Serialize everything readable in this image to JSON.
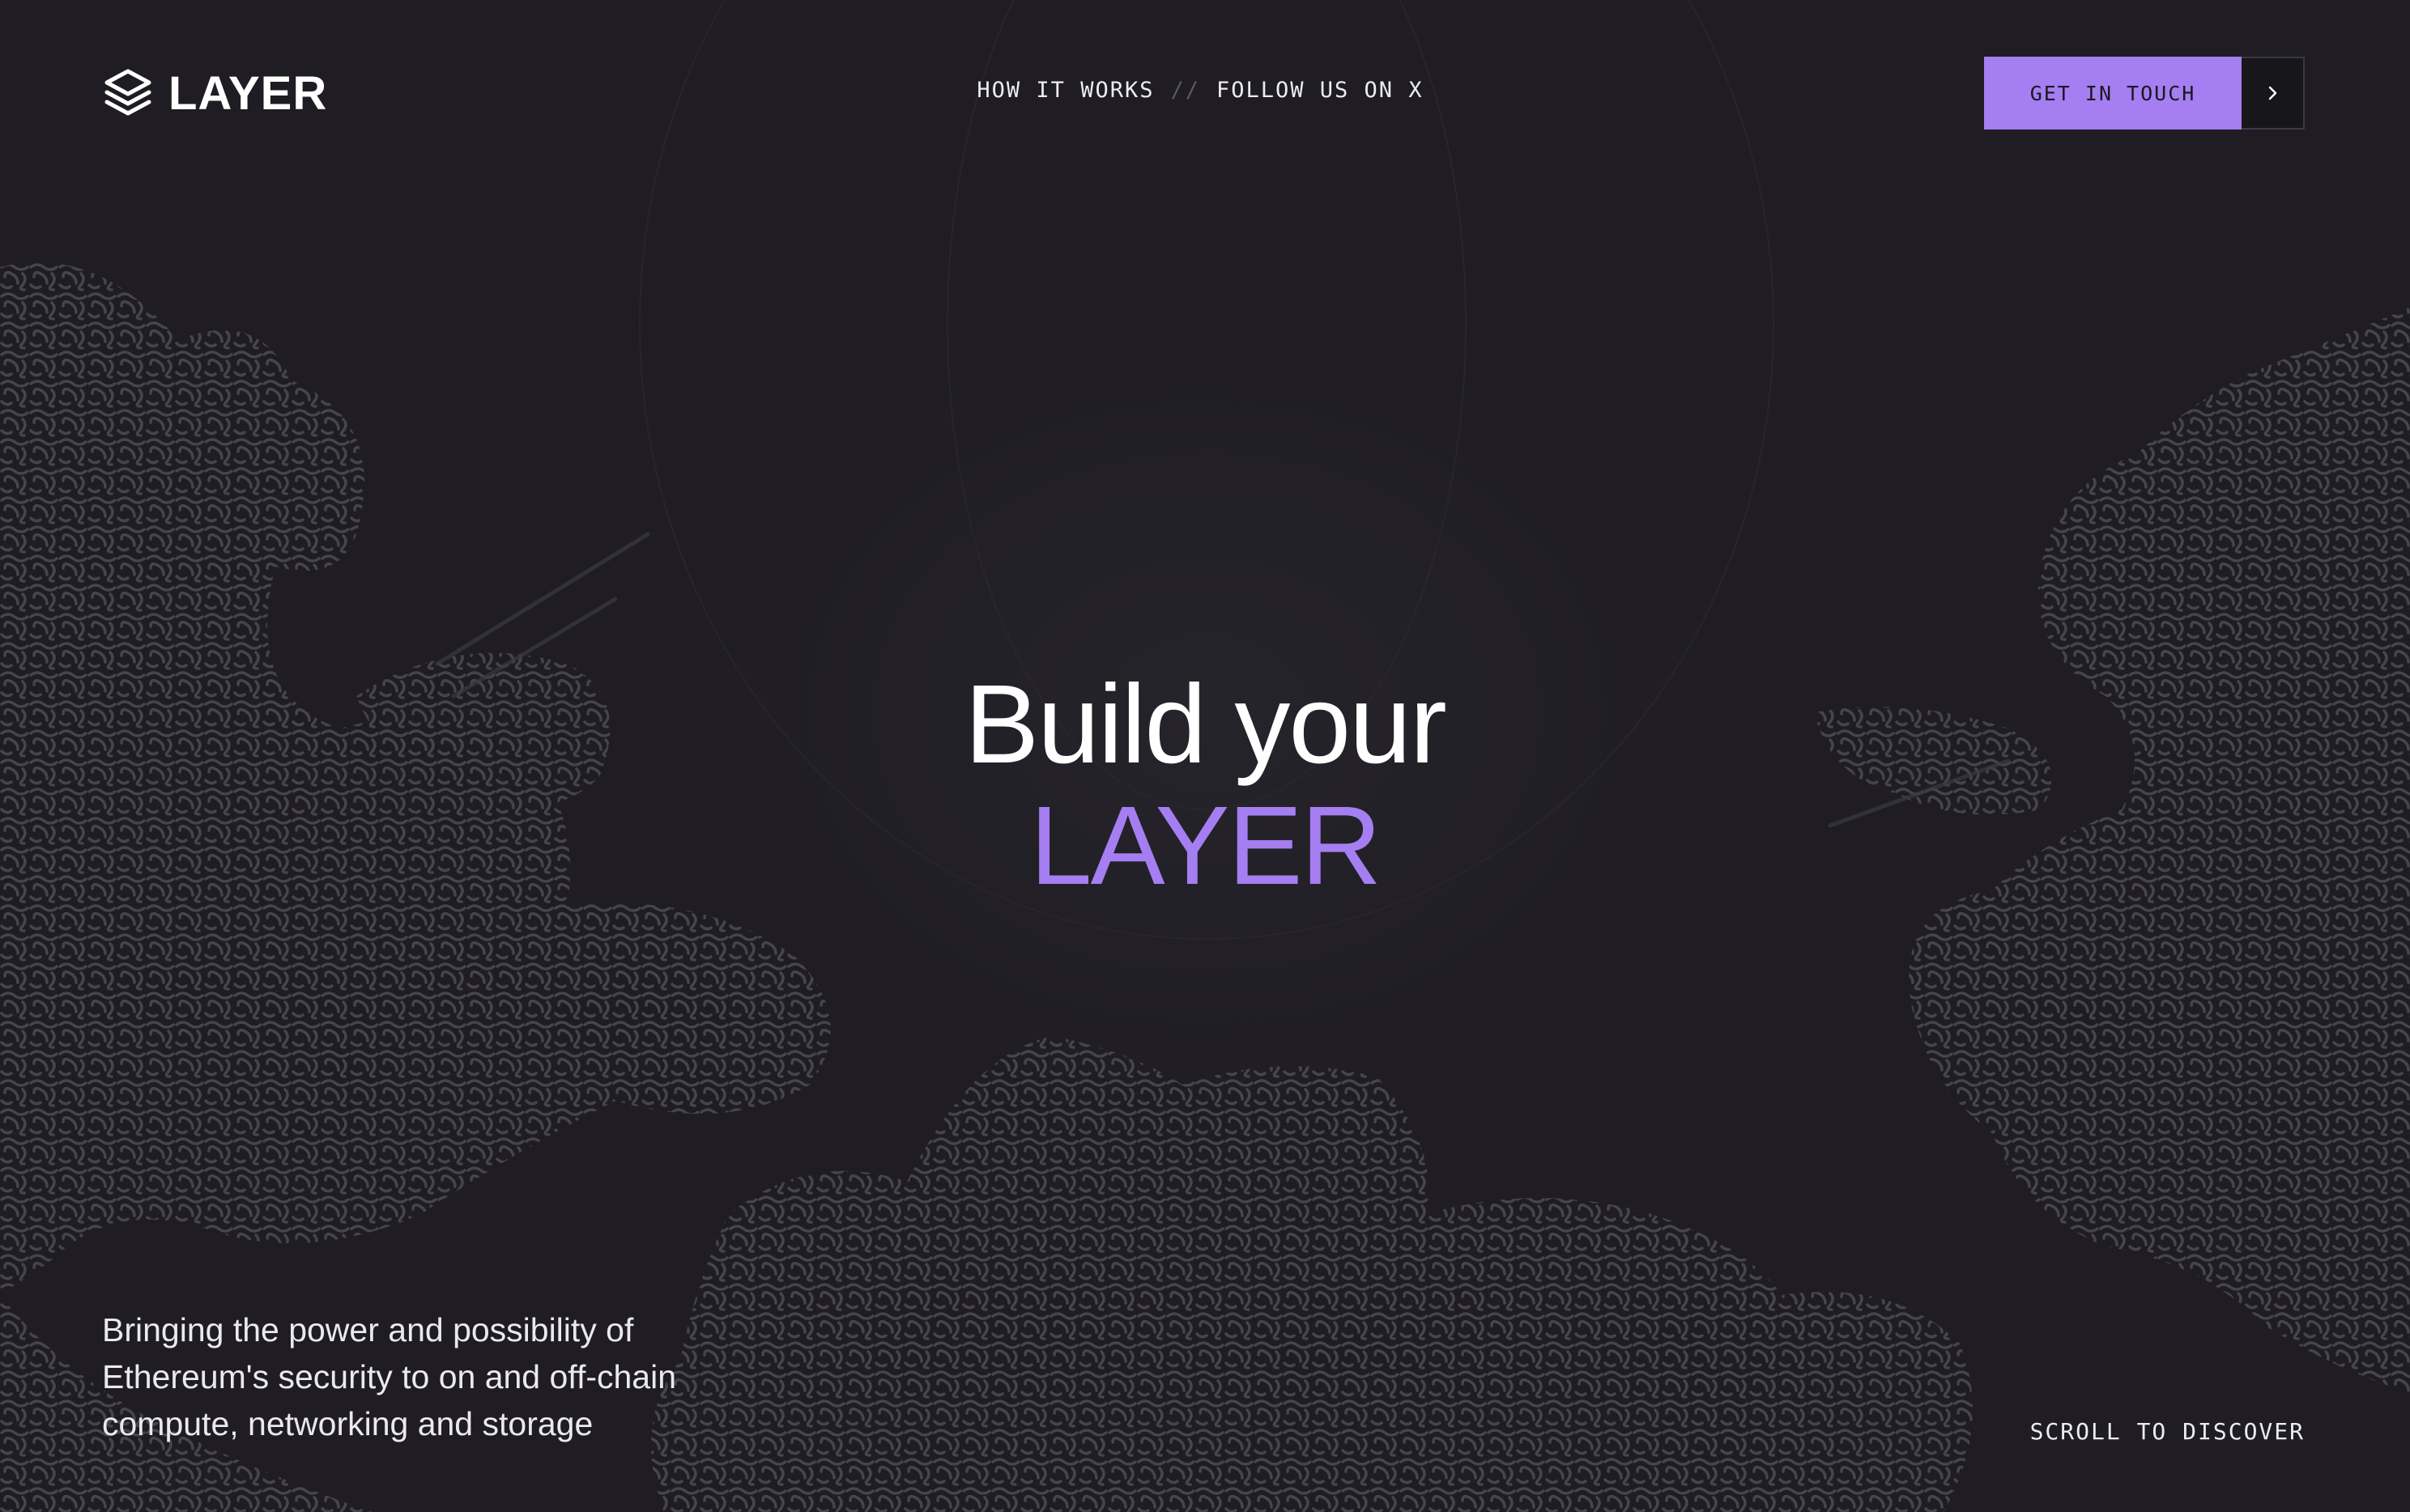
{
  "brand": {
    "name": "LAYER",
    "logo_icon": "layers-stack-icon"
  },
  "nav": {
    "items": [
      {
        "label": "HOW IT WORKS"
      },
      {
        "label": "FOLLOW US ON X"
      }
    ],
    "separator": "//"
  },
  "cta": {
    "label": "GET IN TOUCH",
    "arrow_icon": "chevron-right-icon"
  },
  "hero": {
    "line1": "Build your",
    "line2": "LAYER"
  },
  "tagline": "Bringing the power and possibility of Ethereum's security to on and off-chain compute, networking and storage",
  "scroll_hint": "SCROLL TO DISCOVER",
  "colors": {
    "background": "#1f1d23",
    "accent": "#a57ef2",
    "text": "#ffffff",
    "texture": "#45434c"
  }
}
